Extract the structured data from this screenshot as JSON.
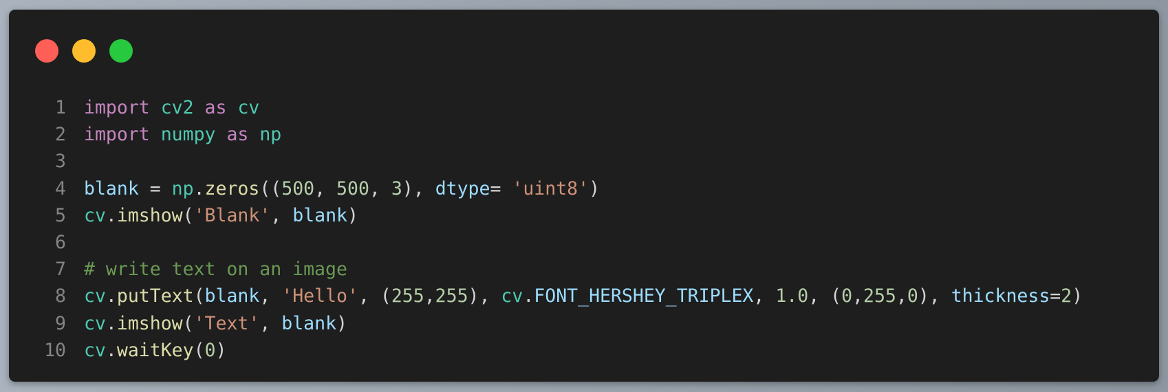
{
  "colors": {
    "background": "#1e1e1e",
    "line_number": "#858585",
    "keyword": "#c586c0",
    "module": "#4ec9b0",
    "variable": "#9cdcfe",
    "function": "#dcdcaa",
    "string": "#ce9178",
    "number": "#b5cea8",
    "comment": "#6a9955",
    "plain": "#d4d4d4",
    "traffic_red": "#ff5f56",
    "traffic_yellow": "#ffbd2e",
    "traffic_green": "#27c93f"
  },
  "window_controls": [
    {
      "name": "close",
      "color": "#ff5f56"
    },
    {
      "name": "minimize",
      "color": "#ffbd2e"
    },
    {
      "name": "maximize",
      "color": "#27c93f"
    }
  ],
  "code": {
    "lines": [
      {
        "number": "1",
        "tokens": [
          {
            "t": "import",
            "k": "keyword"
          },
          {
            "t": " ",
            "k": "plain"
          },
          {
            "t": "cv2",
            "k": "module"
          },
          {
            "t": " ",
            "k": "plain"
          },
          {
            "t": "as",
            "k": "keyword"
          },
          {
            "t": " ",
            "k": "plain"
          },
          {
            "t": "cv",
            "k": "module"
          }
        ]
      },
      {
        "number": "2",
        "tokens": [
          {
            "t": "import",
            "k": "keyword"
          },
          {
            "t": " ",
            "k": "plain"
          },
          {
            "t": "numpy",
            "k": "module"
          },
          {
            "t": " ",
            "k": "plain"
          },
          {
            "t": "as",
            "k": "keyword"
          },
          {
            "t": " ",
            "k": "plain"
          },
          {
            "t": "np",
            "k": "module"
          }
        ]
      },
      {
        "number": "3",
        "tokens": []
      },
      {
        "number": "4",
        "tokens": [
          {
            "t": "blank",
            "k": "variable"
          },
          {
            "t": " = ",
            "k": "plain"
          },
          {
            "t": "np",
            "k": "module"
          },
          {
            "t": ".",
            "k": "plain"
          },
          {
            "t": "zeros",
            "k": "function"
          },
          {
            "t": "((",
            "k": "plain"
          },
          {
            "t": "500",
            "k": "number"
          },
          {
            "t": ", ",
            "k": "plain"
          },
          {
            "t": "500",
            "k": "number"
          },
          {
            "t": ", ",
            "k": "plain"
          },
          {
            "t": "3",
            "k": "number"
          },
          {
            "t": "), ",
            "k": "plain"
          },
          {
            "t": "dtype",
            "k": "variable"
          },
          {
            "t": "= ",
            "k": "plain"
          },
          {
            "t": "'uint8'",
            "k": "string"
          },
          {
            "t": ")",
            "k": "plain"
          }
        ]
      },
      {
        "number": "5",
        "tokens": [
          {
            "t": "cv",
            "k": "module"
          },
          {
            "t": ".",
            "k": "plain"
          },
          {
            "t": "imshow",
            "k": "function"
          },
          {
            "t": "(",
            "k": "plain"
          },
          {
            "t": "'Blank'",
            "k": "string"
          },
          {
            "t": ", ",
            "k": "plain"
          },
          {
            "t": "blank",
            "k": "variable"
          },
          {
            "t": ")",
            "k": "plain"
          }
        ]
      },
      {
        "number": "6",
        "tokens": []
      },
      {
        "number": "7",
        "tokens": [
          {
            "t": "# write text on an image",
            "k": "comment"
          }
        ]
      },
      {
        "number": "8",
        "tokens": [
          {
            "t": "cv",
            "k": "module"
          },
          {
            "t": ".",
            "k": "plain"
          },
          {
            "t": "putText",
            "k": "function"
          },
          {
            "t": "(",
            "k": "plain"
          },
          {
            "t": "blank",
            "k": "variable"
          },
          {
            "t": ", ",
            "k": "plain"
          },
          {
            "t": "'Hello'",
            "k": "string"
          },
          {
            "t": ", (",
            "k": "plain"
          },
          {
            "t": "255",
            "k": "number"
          },
          {
            "t": ",",
            "k": "plain"
          },
          {
            "t": "255",
            "k": "number"
          },
          {
            "t": "), ",
            "k": "plain"
          },
          {
            "t": "cv",
            "k": "module"
          },
          {
            "t": ".",
            "k": "plain"
          },
          {
            "t": "FONT_HERSHEY_TRIPLEX",
            "k": "variable"
          },
          {
            "t": ", ",
            "k": "plain"
          },
          {
            "t": "1.0",
            "k": "number"
          },
          {
            "t": ", (",
            "k": "plain"
          },
          {
            "t": "0",
            "k": "number"
          },
          {
            "t": ",",
            "k": "plain"
          },
          {
            "t": "255",
            "k": "number"
          },
          {
            "t": ",",
            "k": "plain"
          },
          {
            "t": "0",
            "k": "number"
          },
          {
            "t": "), ",
            "k": "plain"
          },
          {
            "t": "thickness",
            "k": "variable"
          },
          {
            "t": "=",
            "k": "plain"
          },
          {
            "t": "2",
            "k": "number"
          },
          {
            "t": ")",
            "k": "plain"
          }
        ]
      },
      {
        "number": "9",
        "tokens": [
          {
            "t": "cv",
            "k": "module"
          },
          {
            "t": ".",
            "k": "plain"
          },
          {
            "t": "imshow",
            "k": "function"
          },
          {
            "t": "(",
            "k": "plain"
          },
          {
            "t": "'Text'",
            "k": "string"
          },
          {
            "t": ", ",
            "k": "plain"
          },
          {
            "t": "blank",
            "k": "variable"
          },
          {
            "t": ")",
            "k": "plain"
          }
        ]
      },
      {
        "number": "10",
        "tokens": [
          {
            "t": "cv",
            "k": "module"
          },
          {
            "t": ".",
            "k": "plain"
          },
          {
            "t": "waitKey",
            "k": "function"
          },
          {
            "t": "(",
            "k": "plain"
          },
          {
            "t": "0",
            "k": "number"
          },
          {
            "t": ")",
            "k": "plain"
          }
        ]
      }
    ]
  }
}
